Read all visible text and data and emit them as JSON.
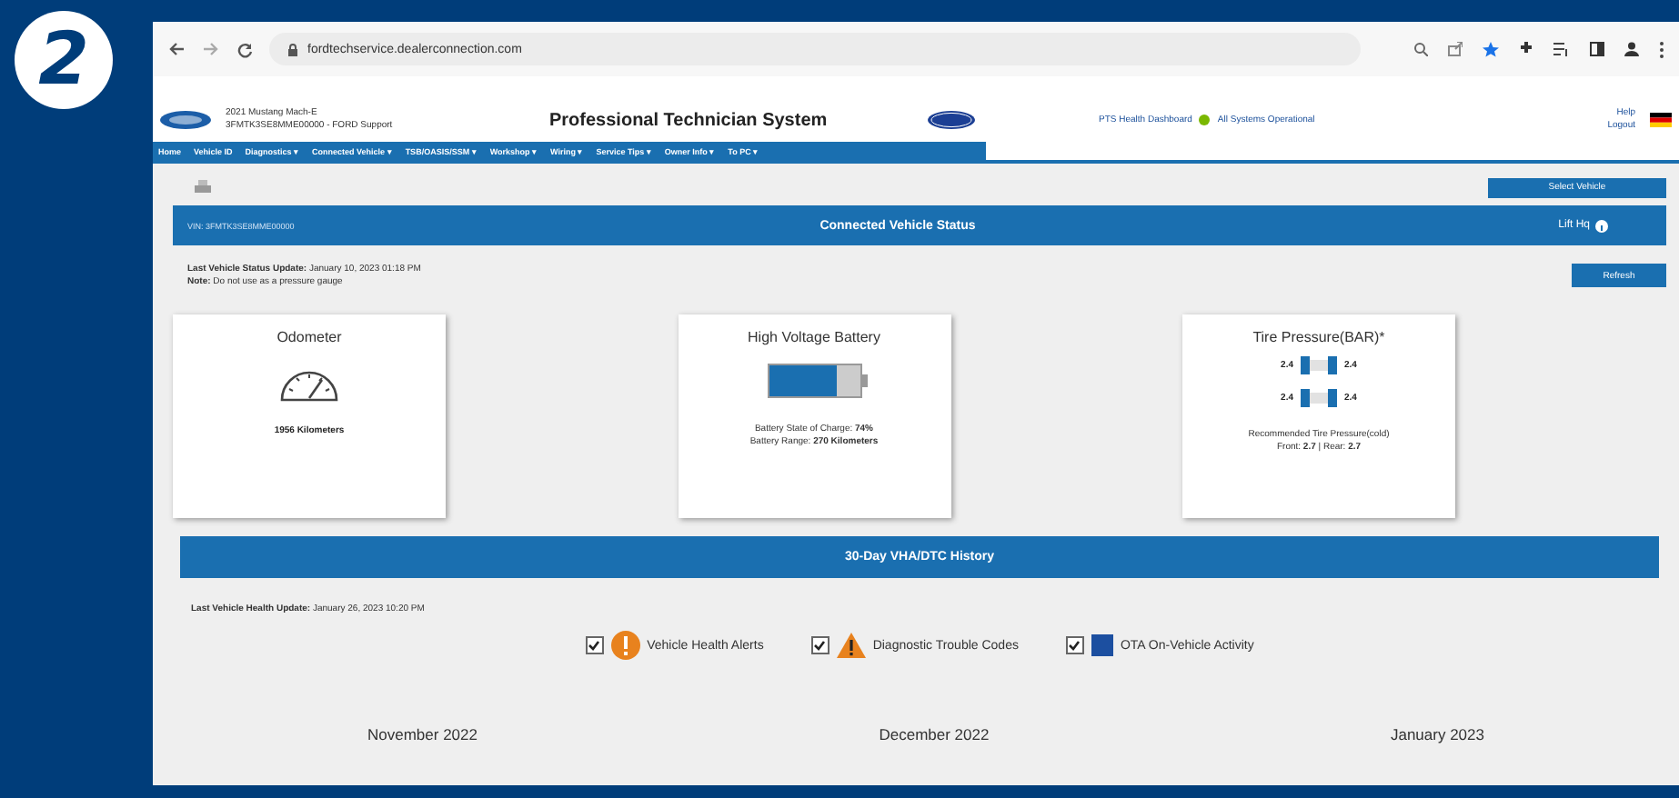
{
  "badge": "2",
  "browser": {
    "url": "fordtechservice.dealerconnection.com"
  },
  "header": {
    "vehicle": "2021 Mustang Mach-E",
    "vin_line": "3FMTK3SE8MME00000 - FORD Support",
    "title": "Professional Technician System",
    "dashboard_link": "PTS Health Dashboard",
    "status": "All Systems Operational",
    "help": "Help",
    "logout": "Logout"
  },
  "nav": [
    "Home",
    "Vehicle ID",
    "Diagnostics ▾",
    "Connected Vehicle ▾",
    "TSB/OASIS/SSM ▾",
    "Workshop ▾",
    "Wiring ▾",
    "Service Tips ▾",
    "Owner Info ▾",
    "To PC ▾"
  ],
  "select_vehicle": "Select Vehicle",
  "status_bar": {
    "vin": "VIN: 3FMTK3SE8MME00000",
    "title": "Connected Vehicle Status",
    "right": "Lift Hq"
  },
  "last_update": {
    "label": "Last Vehicle Status Update:",
    "value": "January 10, 2023 01:18 PM"
  },
  "note": {
    "label": "Note:",
    "value": "Do not use as a pressure gauge"
  },
  "refresh": "Refresh",
  "cards": [
    {
      "kind": "odometer",
      "title": "Odometer",
      "reading": "1956 Kilometers"
    },
    {
      "kind": "battery",
      "title": "High Voltage Battery",
      "level": 0.74,
      "lines": [
        "Battery State of Charge: **74%**",
        "Battery Range: **270 Kilometers**"
      ]
    },
    {
      "kind": "tires",
      "title": "Tire Pressure(BAR)*",
      "tires": [
        "2.4",
        "2.4",
        "2.4",
        "2.4"
      ],
      "lines": [
        "Recommended Tire Pressure(cold)",
        "Front: **2.7** | Rear: **2.7**"
      ]
    }
  ],
  "history": {
    "title": "30-Day VHA/DTC History",
    "last_update_label": "Last Vehicle Health Update:",
    "last_update_value": "January 26, 2023 10:20 PM",
    "legend": [
      {
        "kind": "alert",
        "label": "Vehicle Health Alerts",
        "checked": true
      },
      {
        "kind": "warning",
        "label": "Diagnostic Trouble Codes",
        "checked": true
      },
      {
        "kind": "ota",
        "label": "OTA On-Vehicle Activity",
        "checked": true
      }
    ],
    "months": [
      "November 2022",
      "December 2022",
      "January 2023"
    ]
  }
}
